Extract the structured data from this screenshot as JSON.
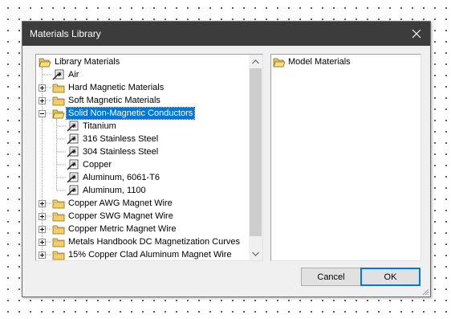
{
  "dialog": {
    "title": "Materials Library",
    "close_glyph": "×"
  },
  "library_tree": {
    "items": [
      {
        "label": "Library Materials",
        "icon": "open-folder-icon",
        "expander": "minus",
        "level": 0
      },
      {
        "label": "Air",
        "icon": "material-icon",
        "expander": "none",
        "level": 1
      },
      {
        "label": "Hard Magnetic Materials",
        "icon": "folder-icon",
        "expander": "plus",
        "level": 1
      },
      {
        "label": "Soft Magnetic Materials",
        "icon": "folder-icon",
        "expander": "plus",
        "level": 1
      },
      {
        "label": "Solid Non-Magnetic Conductors",
        "icon": "open-folder-icon",
        "expander": "minus",
        "level": 1,
        "selected": true
      },
      {
        "label": "Titanium",
        "icon": "material-icon",
        "expander": "none",
        "level": 2
      },
      {
        "label": "316 Stainless Steel",
        "icon": "material-icon",
        "expander": "none",
        "level": 2
      },
      {
        "label": "304 Stainless Steel",
        "icon": "material-icon",
        "expander": "none",
        "level": 2
      },
      {
        "label": "Copper",
        "icon": "material-icon",
        "expander": "none",
        "level": 2
      },
      {
        "label": "Aluminum, 6061-T6",
        "icon": "material-icon",
        "expander": "none",
        "level": 2
      },
      {
        "label": "Aluminum, 1100",
        "icon": "material-icon",
        "expander": "none",
        "level": 2
      },
      {
        "label": "Copper AWG Magnet Wire",
        "icon": "folder-icon",
        "expander": "plus",
        "level": 1
      },
      {
        "label": "Copper SWG Magnet Wire",
        "icon": "folder-icon",
        "expander": "plus",
        "level": 1
      },
      {
        "label": "Copper Metric Magnet Wire",
        "icon": "folder-icon",
        "expander": "plus",
        "level": 1
      },
      {
        "label": "Metals Handbook DC Magnetization Curves",
        "icon": "folder-icon",
        "expander": "plus",
        "level": 1
      },
      {
        "label": "15% Copper Clad Aluminum Magnet Wire",
        "icon": "folder-icon",
        "expander": "plus",
        "level": 1
      }
    ]
  },
  "model_tree": {
    "items": [
      {
        "label": "Model Materials",
        "icon": "open-folder-icon"
      }
    ]
  },
  "buttons": {
    "cancel": "Cancel",
    "ok": "OK"
  },
  "colors": {
    "title_bar": "#3c3c3c",
    "selection": "#0078d7",
    "folder": "#f1d06a"
  }
}
